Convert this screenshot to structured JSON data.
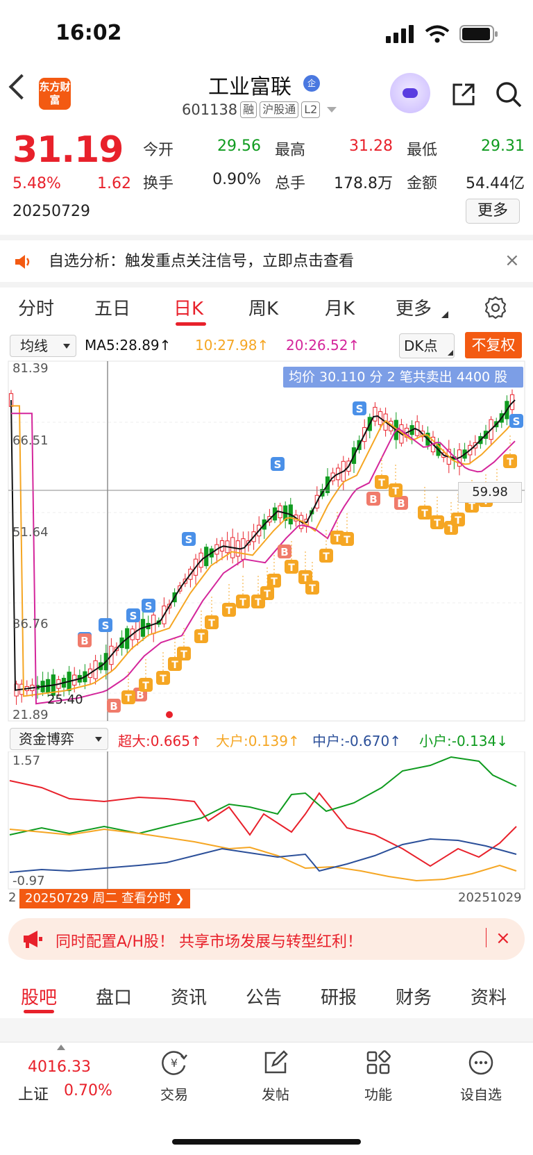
{
  "status": {
    "time": "16:02"
  },
  "header": {
    "logo_text": "东方财富",
    "stock_name": "工业富联",
    "badge": "企",
    "code": "601138",
    "tags": [
      "融",
      "沪股通",
      "L2"
    ]
  },
  "quote": {
    "price": "31.19",
    "pct_change": "5.48%",
    "change": "1.62",
    "date": "20250729",
    "fields": [
      {
        "label": "今开",
        "value": "29.56",
        "color": "#0f9b1f"
      },
      {
        "label": "最高",
        "value": "31.28",
        "color": "#e8212b"
      },
      {
        "label": "最低",
        "value": "29.31",
        "color": "#0f9b1f"
      },
      {
        "label": "换手",
        "value": "0.90%",
        "color": "#222222"
      },
      {
        "label": "总手",
        "value": "178.8万",
        "color": "#222222"
      },
      {
        "label": "金额",
        "value": "54.44亿",
        "color": "#222222"
      }
    ],
    "more_label": "更多"
  },
  "notice": {
    "text": "自选分析：触发重点关注信号，立即点击查看",
    "close": "×"
  },
  "tabs": {
    "items": [
      "分时",
      "五日",
      "日K",
      "周K",
      "月K",
      "更多"
    ],
    "active_index": 2
  },
  "indicator_bar": {
    "select": "均线",
    "ma5": "MA5:28.89↑",
    "ma10": "10:27.98↑",
    "ma20": "20:26.52↑",
    "dk": "DK点",
    "adjust": "不复权"
  },
  "kline": {
    "tooltip": "均价 30.110 分 2 笔共卖出 4400 股",
    "y_ticks": [
      "81.39",
      "66.51",
      "51.64",
      "36.76",
      "21.89"
    ],
    "cross_price": "59.98",
    "low_label": "25.40",
    "colors": {
      "up": "#e8212b",
      "down": "#0f9b1f",
      "ma5": "#111111",
      "ma10": "#f5a623",
      "ma20": "#d4269b"
    }
  },
  "fund_bar": {
    "select": "资金博弈",
    "super": "超大:0.665↑",
    "large": "大户:0.139↑",
    "mid": "中户:-0.670↑",
    "small": "小户:-0.134↓",
    "y_top": "1.57",
    "y_bottom": "-0.97",
    "start_prefix": "2",
    "date_tag": "20250729 周二 查看分时",
    "end_date": "20251029"
  },
  "banner": {
    "text": "同时配置A/H股！ 共享市场发展与转型红利！",
    "close": "×"
  },
  "bottom_tabs": {
    "items": [
      "股吧",
      "盘口",
      "资讯",
      "公告",
      "研报",
      "财务",
      "资料"
    ],
    "active_index": 0
  },
  "bottom_nav": {
    "index_value": "4016.33",
    "index_name": "上证",
    "index_pct": "0.70%",
    "items": [
      "交易",
      "发帖",
      "功能",
      "设自选"
    ]
  }
}
